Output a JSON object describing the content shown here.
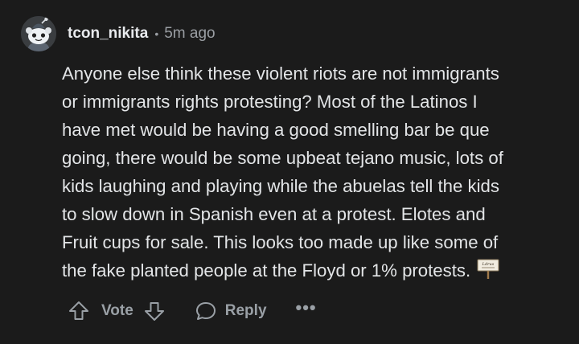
{
  "comment": {
    "author": "tcon_nikita",
    "separator": "•",
    "time": "5m ago",
    "body_lines": [
      "Anyone else think these violent riots are not immigrants",
      "or immigrants rights protesting? Most of the Latinos I",
      "have met would be having a good smelling bar be que",
      "going, there would be some upbeat tejano music, lots of",
      "kids laughing and playing while the abuelas tell the kids",
      "to slow down in Spanish even at a protest. Elotes and",
      "Fruit cups for sale. This looks too made up like some of",
      "the fake planted people at the Floyd or 1% protests."
    ],
    "emote_icon": "protest-sign-emote",
    "emote_text": "Ldrus"
  },
  "actions": {
    "vote_label": "Vote",
    "reply_label": "Reply",
    "more_label": "•••"
  },
  "colors": {
    "background": "#1b1b1b",
    "text": "#e3e5e7",
    "muted": "#9aa0a6"
  }
}
